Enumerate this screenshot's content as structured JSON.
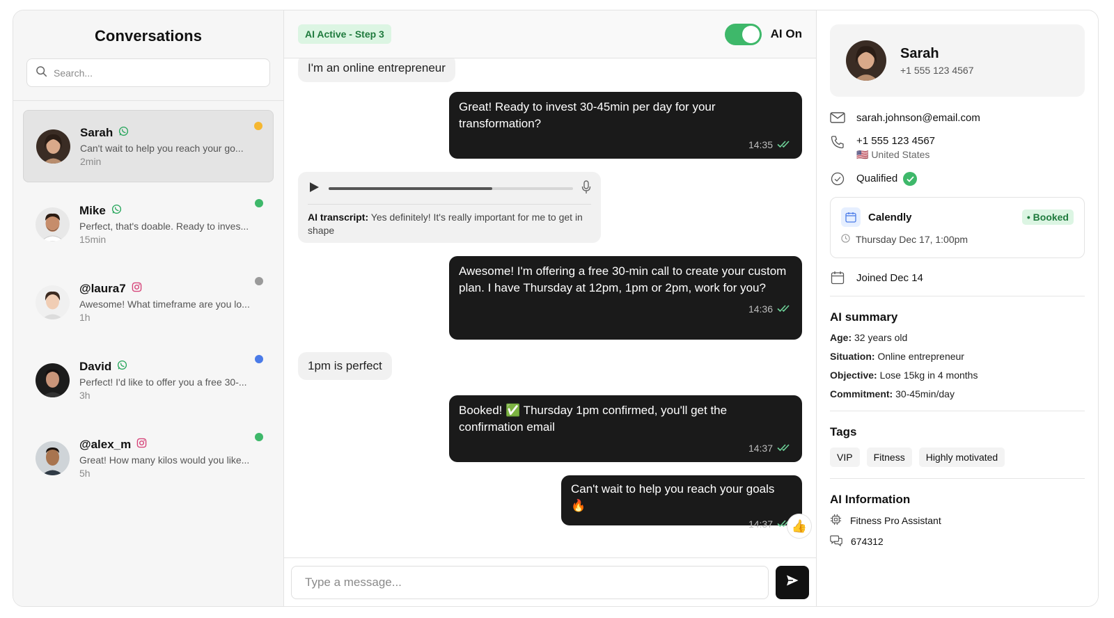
{
  "sidebar": {
    "title": "Conversations",
    "search_placeholder": "Search...",
    "conversations": [
      {
        "name": "Sarah",
        "channel": "whatsapp-icon",
        "preview": "Can't wait to help you reach your go...",
        "time": "2min",
        "dot_color": "#f5b731",
        "active": true
      },
      {
        "name": "Mike",
        "channel": "whatsapp-icon",
        "preview": "Perfect, that's doable. Ready to inves...",
        "time": "15min",
        "dot_color": "#3eb86a"
      },
      {
        "name": "@laura7",
        "channel": "instagram-icon",
        "preview": "Awesome! What timeframe are you lo...",
        "time": "1h",
        "dot_color": "#9a9a9a"
      },
      {
        "name": "David",
        "channel": "whatsapp-icon",
        "preview": "Perfect! I'd like to offer you a free 30-...",
        "time": "3h",
        "dot_color": "#4a7be8"
      },
      {
        "name": "@alex_m",
        "channel": "instagram-icon",
        "preview": "Great! How many kilos would you like...",
        "time": "5h",
        "dot_color": "#3eb86a"
      }
    ]
  },
  "chat": {
    "status_badge": "AI Active - Step 3",
    "toggle_label": "AI On",
    "messages": [
      {
        "direction": "in",
        "text": "I'm an online entrepreneur"
      },
      {
        "direction": "out",
        "text": "Great! Ready to invest 30-45min per day for your transformation?",
        "time": "14:35"
      },
      {
        "direction": "voice",
        "progress": 0.67,
        "transcript_label": "AI transcript:",
        "transcript": "Yes definitely! It's really important for me to get in shape"
      },
      {
        "direction": "out",
        "text": "Awesome! I'm offering a free 30-min call to create your custom plan. I have Thursday at 12pm, 1pm or 2pm, work for you?",
        "time": "14:36"
      },
      {
        "direction": "in",
        "text": "1pm is perfect"
      },
      {
        "direction": "out",
        "text": "Booked! ✅ Thursday 1pm confirmed, you'll get the confirmation email",
        "time": "14:37"
      },
      {
        "direction": "out",
        "text": "Can't wait to help you reach your goals 🔥",
        "time": "14:37",
        "reaction": "👍"
      }
    ],
    "composer_placeholder": "Type a message..."
  },
  "profile": {
    "name": "Sarah",
    "phone": "+1 555 123 4567",
    "email": "sarah.johnson@email.com",
    "contact_phone": "+1 555 123 4567",
    "country": "🇺🇸 United States",
    "status": "Qualified",
    "calendar": {
      "provider": "Calendly",
      "badge": "• Booked",
      "time": "Thursday Dec 17, 1:00pm"
    },
    "joined": "Joined Dec 14",
    "ai_summary": {
      "title": "AI summary",
      "items": [
        {
          "label": "Age:",
          "value": "32 years old"
        },
        {
          "label": "Situation:",
          "value": "Online entrepreneur"
        },
        {
          "label": "Objective:",
          "value": "Lose 15kg in 4 months"
        },
        {
          "label": "Commitment:",
          "value": "30-45min/day"
        }
      ]
    },
    "tags_title": "Tags",
    "tags": [
      "VIP",
      "Fitness",
      "Highly motivated"
    ],
    "ai_info": {
      "title": "AI Information",
      "assistant": "Fitness Pro Assistant",
      "id": "674312"
    }
  },
  "colors": {
    "accent_green": "#3eb86a",
    "dark_bubble": "#1a1a1a",
    "instagram": "#d6457a",
    "whatsapp": "#25a55a"
  }
}
